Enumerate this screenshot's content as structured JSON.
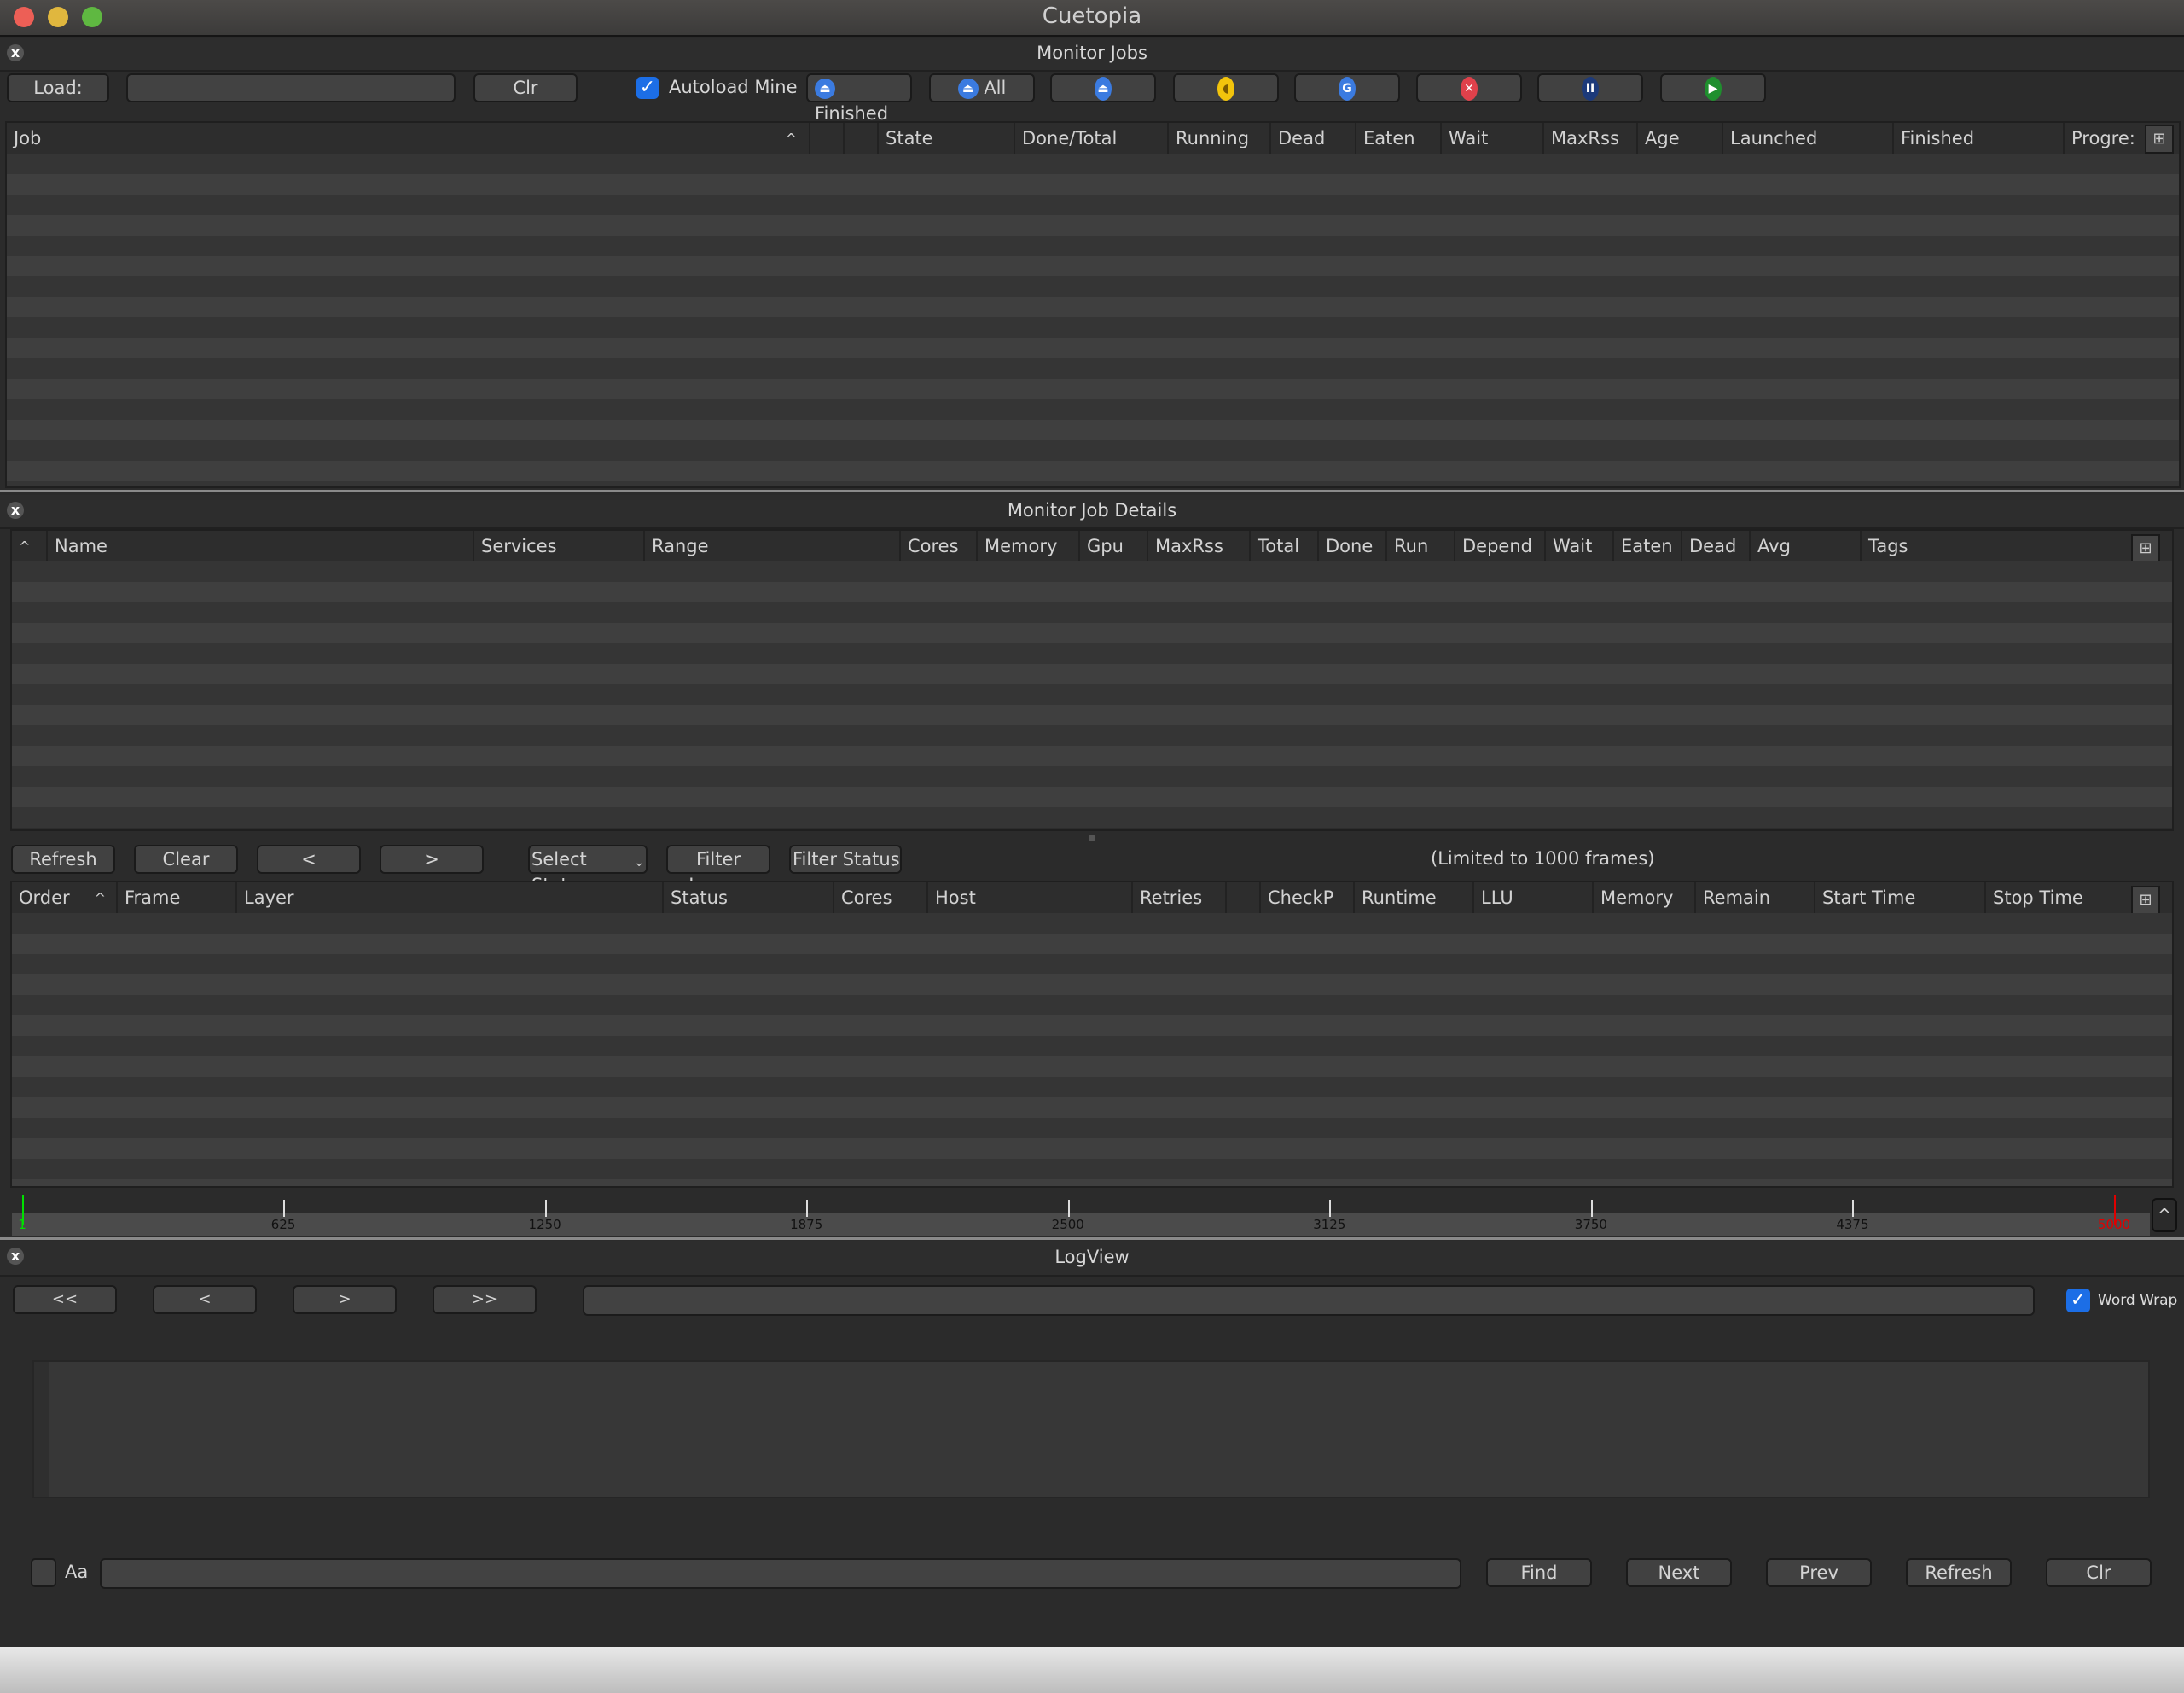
{
  "window": {
    "title": "Cuetopia",
    "traffic_lights": {
      "close": "#ed5f56",
      "minimize": "#e0b73e",
      "zoom": "#5fb841"
    }
  },
  "monitor_jobs": {
    "title": "Monitor Jobs",
    "close_icon": "close-icon",
    "toolbar": {
      "load_label": "Load:",
      "load_input_value": "",
      "clr_label": "Clr",
      "autoload_label": "Autoload Mine",
      "autoload_checked": true,
      "finished_label": "Finished",
      "all_label": "All",
      "icon_buttons": [
        {
          "name": "eat-dead-frames",
          "icon": "eject-icon",
          "color": "#3b7be0"
        },
        {
          "name": "eat-frames",
          "icon": "pacman-icon",
          "color": "#f2c40c"
        },
        {
          "name": "retry-frames",
          "icon": "retry-icon",
          "color": "#3b7be0"
        },
        {
          "name": "kill-job",
          "icon": "kill-icon",
          "color": "#e0414b"
        },
        {
          "name": "pause-job",
          "icon": "pause-icon",
          "color": "#1d3a7a"
        },
        {
          "name": "unpause-job",
          "icon": "play-icon",
          "color": "#1f8f2e"
        }
      ]
    },
    "columns": [
      "Job",
      "",
      "",
      "State",
      "Done/Total",
      "Running",
      "Dead",
      "Eaten",
      "Wait",
      "MaxRss",
      "Age",
      "Launched",
      "Finished",
      "Progre:"
    ],
    "sort_indicator": "^",
    "rows": []
  },
  "job_details": {
    "title": "Monitor Job Details",
    "layer_columns": [
      "Name",
      "Services",
      "Range",
      "Cores",
      "Memory",
      "Gpu",
      "MaxRss",
      "Total",
      "Done",
      "Run",
      "Depend",
      "Wait",
      "Eaten",
      "Dead",
      "Avg",
      "Tags"
    ],
    "sort_indicator": "^",
    "layer_rows": [],
    "frame_toolbar": {
      "refresh_label": "Refresh",
      "clear_label": "Clear",
      "prev_label": "<",
      "next_label": ">",
      "select_status_label": "Select Status",
      "filter_layers_label": "Filter Layers",
      "filter_status_label": "Filter Status",
      "limit_text": "(Limited to 1000 frames)"
    },
    "frame_columns": [
      "Order",
      "Frame",
      "Layer",
      "Status",
      "Cores",
      "Host",
      "Retries",
      "",
      "CheckP",
      "Runtime",
      "LLU",
      "Memory",
      "Remain",
      "Start Time",
      "Stop Time"
    ],
    "frame_rows": [],
    "timeline": {
      "min": 1,
      "max": 5000,
      "ticks": [
        1,
        625,
        1250,
        1875,
        2500,
        3125,
        3750,
        4375,
        5000
      ],
      "start_marker_color": "#00e000",
      "end_marker_color": "#e00000",
      "collapse_label": "^"
    }
  },
  "logview": {
    "title": "LogView",
    "nav": {
      "first": "<<",
      "prev": "<",
      "next": ">",
      "last": ">>"
    },
    "path_value": "",
    "word_wrap_label": "Word Wrap",
    "word_wrap_checked": true,
    "log_text": "",
    "search": {
      "case_label": "Aa",
      "case_checked": false,
      "query_value": "",
      "find_label": "Find",
      "next_label": "Next",
      "prev_label": "Prev",
      "refresh_label": "Refresh",
      "clr_label": "Clr"
    }
  }
}
